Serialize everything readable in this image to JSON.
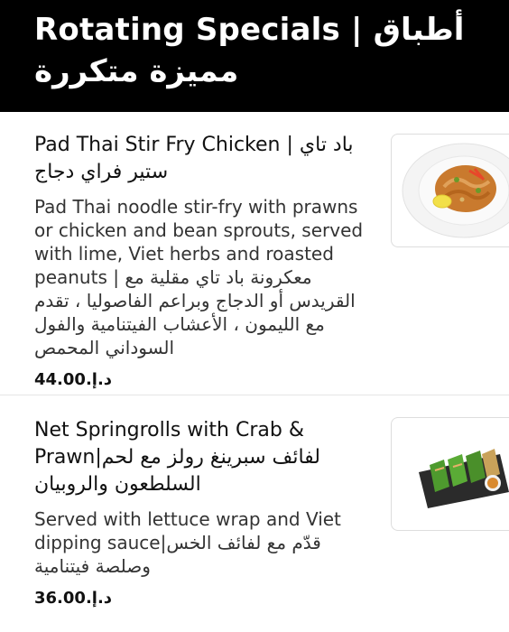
{
  "header": {
    "title": "Rotating Specials | أطباق مميزة متكررة"
  },
  "items": [
    {
      "title": "Pad Thai Stir Fry Chicken | باد تاي ستير فراي دجاج",
      "description": "Pad Thai noodle stir-fry with prawns or chicken and bean sprouts, served with lime, Viet herbs and roasted peanuts | معكرونة باد تاي مقلية مع القريدس أو الدجاج وبراعم الفاصوليا ، تقدم مع الليمون ، الأعشاب الفيتنامية والفول السوداني المحمص",
      "price": "د.إ.44.00",
      "image_icon": "pad-thai-dish-photo"
    },
    {
      "title": "Net Springrolls with Crab & Prawn|لفائف سبرينغ رولز مع لحم السلطعون والروبيان",
      "description": "Served with lettuce wrap and Viet dipping sauce|قدّم مع لفائف الخس وصلصة فيتنامية",
      "price": "د.إ.36.00",
      "image_icon": "springrolls-dish-photo"
    }
  ]
}
